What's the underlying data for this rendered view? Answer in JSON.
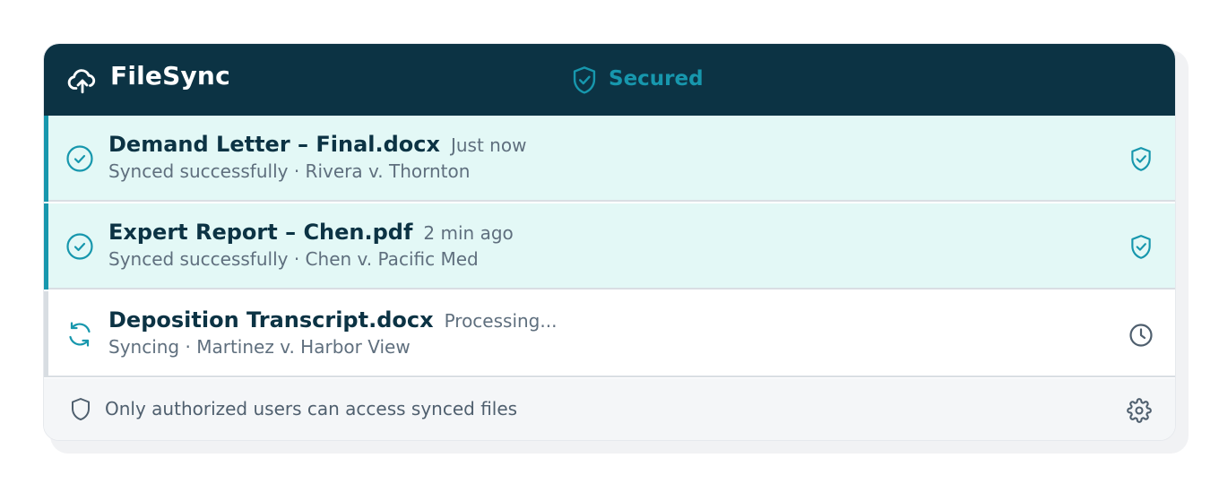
{
  "app": {
    "title": "FileSync",
    "logo_icon": "cloud-upload-icon"
  },
  "header": {
    "security_status": "Secured",
    "security_icon": "shield-check-icon"
  },
  "colors": {
    "header_bg": "#0c3344",
    "accent": "#1797ad",
    "synced_row_bg": "#e3f8f6",
    "footer_bg": "#f4f6f8"
  },
  "files": [
    {
      "name": "Demand Letter – Final.docx",
      "time": "Just now",
      "status": "Synced successfully",
      "matter": "Rivera v. Thornton",
      "state_icon": "check-circle-icon",
      "right_icon": "shield-check-icon"
    },
    {
      "name": "Expert Report – Chen.pdf",
      "time": "2 min ago",
      "status": "Synced successfully",
      "matter": "Chen v. Pacific Med",
      "state_icon": "check-circle-icon",
      "right_icon": "shield-check-icon"
    },
    {
      "name": "Deposition Transcript.docx",
      "time": "Processing...",
      "status": "Syncing",
      "matter": "Martinez v. Harbor View",
      "state_icon": "sync-icon",
      "right_icon": "clock-icon"
    }
  ],
  "footer": {
    "note": "Only authorized users can access synced files",
    "note_icon": "shield-outline-icon",
    "settings_icon": "gear-icon"
  }
}
